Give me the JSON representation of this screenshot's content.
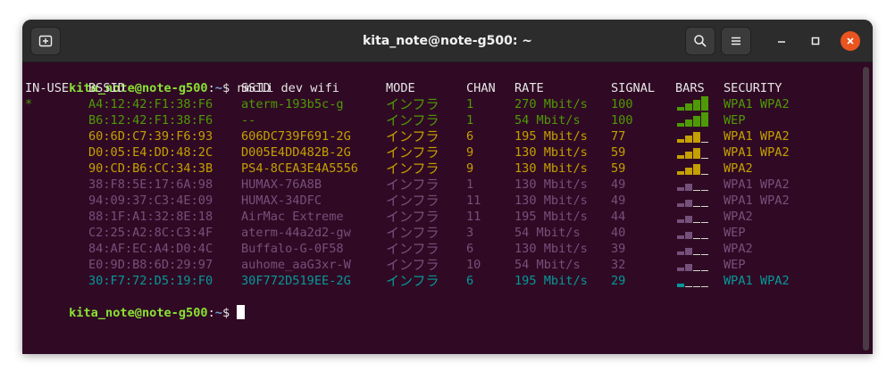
{
  "window": {
    "title": "kita_note@note-g500: ~"
  },
  "icons": {
    "new_tab": "new-tab-icon",
    "search": "search-icon",
    "menu": "hamburger-menu-icon",
    "minimize": "minimize-icon",
    "maximize": "maximize-icon",
    "close": "close-icon"
  },
  "colors": {
    "background": "#300a24",
    "prompt_user": "#8ae234",
    "prompt_path": "#729fcf",
    "strong": "#4e9a06",
    "medium": "#c4a000",
    "weak": "#75507b",
    "poor": "#06989a",
    "bar_inactive": "#d3d7cf",
    "close_button": "#e95420"
  },
  "terminal": {
    "prompt_user": "kita_note@note-g500",
    "prompt_sep": ":",
    "prompt_path": "~",
    "prompt_symbol": "$ ",
    "command": "nmcli dev wifi",
    "headers": {
      "in_use": "IN-USE",
      "bssid": "BSSID",
      "ssid": "SSID",
      "mode": "MODE",
      "chan": "CHAN",
      "rate": "RATE",
      "signal": "SIGNAL",
      "bars": "BARS",
      "security": "SECURITY"
    },
    "rows": [
      {
        "in_use": "*",
        "bssid": "A4:12:42:F1:38:F6",
        "ssid": "aterm-193b5c-g",
        "mode": "インフラ",
        "chan": "1",
        "rate": "270 Mbit/s",
        "signal": "100",
        "bars": 4,
        "strength": "strong",
        "security": "WPA1 WPA2"
      },
      {
        "in_use": "",
        "bssid": "B6:12:42:F1:38:F6",
        "ssid": "--",
        "mode": "インフラ",
        "chan": "1",
        "rate": "54 Mbit/s",
        "signal": "100",
        "bars": 4,
        "strength": "strong",
        "security": "WEP"
      },
      {
        "in_use": "",
        "bssid": "60:6D:C7:39:F6:93",
        "ssid": "606DC739F691-2G",
        "mode": "インフラ",
        "chan": "6",
        "rate": "195 Mbit/s",
        "signal": "77",
        "bars": 3,
        "strength": "medium",
        "security": "WPA1 WPA2"
      },
      {
        "in_use": "",
        "bssid": "D0:05:E4:DD:48:2C",
        "ssid": "D005E4DD482B-2G",
        "mode": "インフラ",
        "chan": "9",
        "rate": "130 Mbit/s",
        "signal": "59",
        "bars": 3,
        "strength": "medium",
        "security": "WPA1 WPA2"
      },
      {
        "in_use": "",
        "bssid": "90:CD:B6:CC:34:3B",
        "ssid": "PS4-8CEA3E4A5556",
        "mode": "インフラ",
        "chan": "9",
        "rate": "130 Mbit/s",
        "signal": "59",
        "bars": 3,
        "strength": "medium",
        "security": "WPA2"
      },
      {
        "in_use": "",
        "bssid": "38:F8:5E:17:6A:98",
        "ssid": "HUMAX-76A8B",
        "mode": "インフラ",
        "chan": "1",
        "rate": "130 Mbit/s",
        "signal": "49",
        "bars": 2,
        "strength": "weak",
        "security": "WPA1 WPA2"
      },
      {
        "in_use": "",
        "bssid": "94:09:37:C3:4E:09",
        "ssid": "HUMAX-34DFC",
        "mode": "インフラ",
        "chan": "11",
        "rate": "130 Mbit/s",
        "signal": "49",
        "bars": 2,
        "strength": "weak",
        "security": "WPA1 WPA2"
      },
      {
        "in_use": "",
        "bssid": "88:1F:A1:32:8E:18",
        "ssid": "AirMac Extreme",
        "mode": "インフラ",
        "chan": "11",
        "rate": "195 Mbit/s",
        "signal": "44",
        "bars": 2,
        "strength": "weak",
        "security": "WPA2"
      },
      {
        "in_use": "",
        "bssid": "C2:25:A2:8C:C3:4F",
        "ssid": "aterm-44a2d2-gw",
        "mode": "インフラ",
        "chan": "3",
        "rate": "54 Mbit/s",
        "signal": "40",
        "bars": 2,
        "strength": "weak",
        "security": "WEP"
      },
      {
        "in_use": "",
        "bssid": "84:AF:EC:A4:D0:4C",
        "ssid": "Buffalo-G-0F58",
        "mode": "インフラ",
        "chan": "6",
        "rate": "130 Mbit/s",
        "signal": "39",
        "bars": 2,
        "strength": "weak",
        "security": "WPA2"
      },
      {
        "in_use": "",
        "bssid": "E0:9D:B8:6D:29:97",
        "ssid": "auhome_aaG3xr-W",
        "mode": "インフラ",
        "chan": "10",
        "rate": "54 Mbit/s",
        "signal": "32",
        "bars": 2,
        "strength": "weak",
        "security": "WEP"
      },
      {
        "in_use": "",
        "bssid": "30:F7:72:D5:19:F0",
        "ssid": "30F772D519EE-2G",
        "mode": "インフラ",
        "chan": "6",
        "rate": "195 Mbit/s",
        "signal": "29",
        "bars": 1,
        "strength": "poor",
        "security": "WPA1 WPA2"
      }
    ]
  }
}
